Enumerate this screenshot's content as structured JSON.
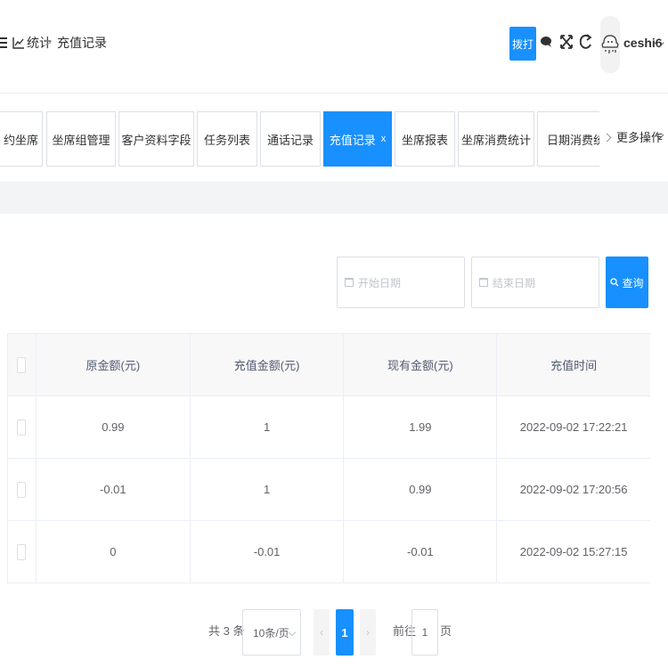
{
  "header": {
    "breadcrumb": [
      "统计",
      "充值记录"
    ],
    "dial_label": "拨打",
    "username": "ceshi6"
  },
  "tags": [
    {
      "label": "约坐席",
      "active": false
    },
    {
      "label": "坐席组管理",
      "active": false
    },
    {
      "label": "客户资料字段",
      "active": false
    },
    {
      "label": "任务列表",
      "active": false
    },
    {
      "label": "通话记录",
      "active": false
    },
    {
      "label": "充值记录",
      "active": true,
      "close": "x"
    },
    {
      "label": "坐席报表",
      "active": false
    },
    {
      "label": "坐席消费统计",
      "active": false
    },
    {
      "label": "日期消费统计",
      "active": false
    }
  ],
  "more_ops": "更多操作",
  "filters": {
    "start_placeholder": "开始日期",
    "end_placeholder": "结束日期",
    "query_label": "查询"
  },
  "table": {
    "columns": [
      "原金额(元)",
      "充值金额(元)",
      "现有金额(元)",
      "充值时间"
    ],
    "rows": [
      [
        "0.99",
        "1",
        "1.99",
        "2022-09-02 17:22:21"
      ],
      [
        "-0.01",
        "1",
        "0.99",
        "2022-09-02 17:20:56"
      ],
      [
        "0",
        "-0.01",
        "-0.01",
        "2022-09-02 15:27:15"
      ]
    ]
  },
  "pagination": {
    "total_text": "共 3 条",
    "page_size": "10条/页",
    "prev": "‹",
    "current_page": "1",
    "next": "›",
    "goto_label": "前往",
    "goto_value": "1",
    "page_suffix": "页"
  },
  "colors": {
    "accent": "#1890ff",
    "border": "#dcdfe6",
    "table_header_bg": "#f8f8f9"
  }
}
